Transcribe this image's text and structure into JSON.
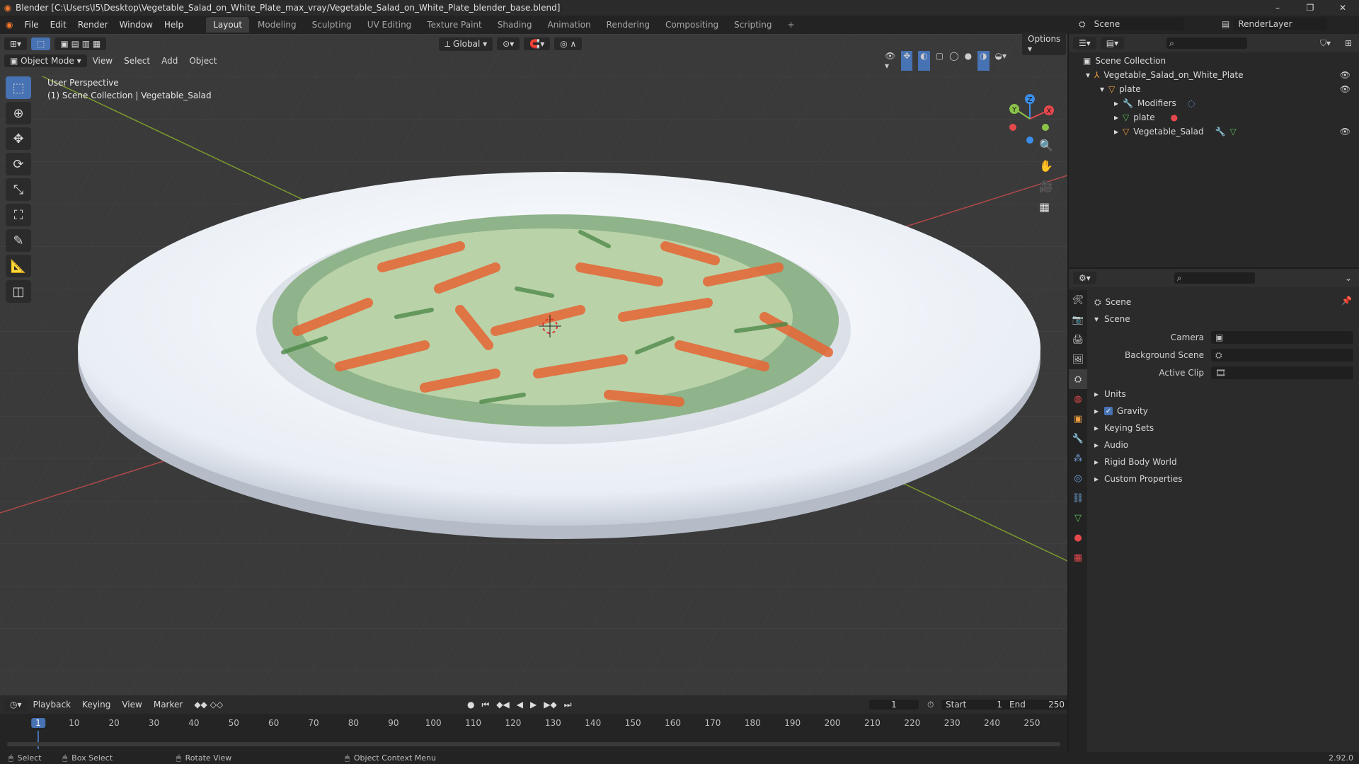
{
  "window": {
    "title": "Blender [C:\\Users\\I5\\Desktop\\Vegetable_Salad_on_White_Plate_max_vray/Vegetable_Salad_on_White_Plate_blender_base.blend]",
    "controls": [
      "–",
      "❐",
      "✕"
    ]
  },
  "menu": [
    "File",
    "Edit",
    "Render",
    "Window",
    "Help"
  ],
  "workspaces": [
    "Layout",
    "Modeling",
    "Sculpting",
    "UV Editing",
    "Texture Paint",
    "Shading",
    "Animation",
    "Rendering",
    "Compositing",
    "Scripting",
    "+"
  ],
  "scene_selector": "Scene",
  "renderlayer_selector": "RenderLayer",
  "viewport": {
    "mode": "Object Mode",
    "menus": [
      "View",
      "Select",
      "Add",
      "Object"
    ],
    "orientation": "Global",
    "options": "Options",
    "overlay_line1": "User Perspective",
    "overlay_line2": "(1) Scene Collection | Vegetable_Salad",
    "gizmo_axes": [
      "X",
      "Y",
      "Z"
    ]
  },
  "outliner": {
    "root": "Scene Collection",
    "items": [
      {
        "label": "Vegetable_Salad_on_White_Plate",
        "depth": 1
      },
      {
        "label": "plate",
        "depth": 2
      },
      {
        "label": "Modifiers",
        "depth": 3
      },
      {
        "label": "plate",
        "depth": 3
      },
      {
        "label": "Vegetable_Salad",
        "depth": 3
      }
    ]
  },
  "properties": {
    "context": "Scene",
    "panel": "Scene",
    "fields": [
      {
        "label": "Camera",
        "value": ""
      },
      {
        "label": "Background Scene",
        "value": ""
      },
      {
        "label": "Active Clip",
        "value": ""
      }
    ],
    "subpanels": [
      "Units",
      "Gravity",
      "Keying Sets",
      "Audio",
      "Rigid Body World",
      "Custom Properties"
    ],
    "gravity_checked": true
  },
  "timeline": {
    "menus": [
      "Playback",
      "Keying",
      "View",
      "Marker"
    ],
    "current_frame": "1",
    "start_label": "Start",
    "start": "1",
    "end_label": "End",
    "end": "250",
    "ticks": [
      "1",
      "10",
      "20",
      "30",
      "40",
      "50",
      "60",
      "70",
      "80",
      "90",
      "100",
      "110",
      "120",
      "130",
      "140",
      "150",
      "160",
      "170",
      "180",
      "190",
      "200",
      "210",
      "220",
      "230",
      "240",
      "250"
    ]
  },
  "statusbar": {
    "select": "Select",
    "box_select": "Box Select",
    "rotate": "Rotate View",
    "context_menu": "Object Context Menu",
    "version": "2.92.0"
  },
  "colors": {
    "accent": "#4772b3",
    "active_frame": "#4772b3",
    "axis_x": "#e5484d",
    "axis_y": "#8bc34a",
    "axis_z": "#3b8ee8"
  }
}
